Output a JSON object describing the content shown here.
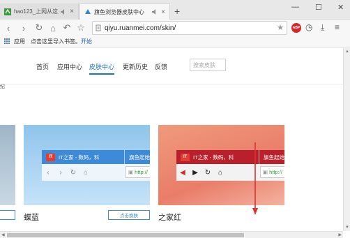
{
  "tabs": [
    {
      "title": "hao123_上网从这里开",
      "active": false
    },
    {
      "title": "旗鱼浏览器皮肤中心",
      "active": true
    }
  ],
  "new_tab_label": "+",
  "window_controls": {
    "minimize": "—",
    "maximize": "☐",
    "close": "✕"
  },
  "toolbar": {
    "url": "qiyu.ruanmei.com/skin/",
    "abp_label": "ABP"
  },
  "bookmarks": {
    "apps_label": "应用",
    "import_hint": "点击这里导入书签。",
    "start_label": "开始"
  },
  "site_nav": {
    "items": [
      {
        "label": "首页",
        "active": false
      },
      {
        "label": "应用中心",
        "active": false
      },
      {
        "label": "皮肤中心",
        "active": true
      },
      {
        "label": "更新历史",
        "active": false
      },
      {
        "label": "反馈",
        "active": false
      }
    ],
    "search_placeholder": "搜索皮肤"
  },
  "left_partial_text": "纪",
  "skins": [
    {
      "name": "蝶蓝",
      "tab_title": "IT之家 - 数码，科",
      "tab2_title": "旗鱼起始",
      "addr": "http://",
      "button": "点击换肤"
    },
    {
      "name": "之家红",
      "tab_title": "IT之家 - 数码，科",
      "tab2_title": "旗鱼起始",
      "addr": "http://",
      "button": ""
    }
  ],
  "mini_logo": "IT",
  "colors": {
    "accent_blue": "#1a73c5",
    "skin_blue_tab": "#3d8ad8",
    "skin_red_tab": "#b9202b",
    "arrow_red": "#e03030"
  }
}
